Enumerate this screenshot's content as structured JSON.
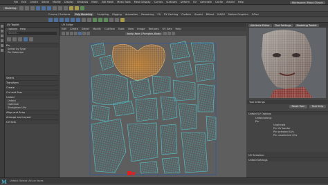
{
  "app": {
    "menus": [
      "File",
      "Edit",
      "Create",
      "Select",
      "Modify",
      "Display",
      "Windows",
      "Mesh",
      "Edit Mesh",
      "Mesh Tools",
      "Mesh Display",
      "Curves",
      "Surfaces",
      "Deform",
      "UV",
      "Generate",
      "Cache",
      "Arnold",
      "Help"
    ],
    "workspace_label": "Workspace: Maya Classic",
    "mode": "Modeling"
  },
  "shelf_tabs": [
    "Curves / Surfaces",
    "Poly Modeling",
    "Sculpting",
    "Rigging",
    "Animation",
    "Rendering",
    "FX",
    "FX Caching",
    "Custom",
    "Arnold",
    "Bifrost",
    "MASH",
    "Motion Graphics",
    "XGen"
  ],
  "active_shelf_tab": "Poly Modeling",
  "uv_toolkit": {
    "title": "UV Toolkit",
    "menus": [
      "Options",
      "Help"
    ],
    "search_placeholder": "Search...",
    "sections": [
      "Pin",
      "Select",
      "Transform",
      "Create",
      "Cut and Sew",
      "Unfold",
      "Align and Snap",
      "Arrange and Layout",
      "UV Sets"
    ],
    "top_rows": [
      "Select by Type",
      "Pin Selection",
      "Invert Pin",
      "Unpin All"
    ],
    "lower_rows": [
      "Unfold",
      "Optimize",
      "Straighten UVs",
      "Layout",
      "Orient Shells",
      "Stack and Orient",
      "Snap Together",
      "Distribute"
    ]
  },
  "uv_editor": {
    "title": "UV Editor",
    "menus": [
      "Edit",
      "Create",
      "Select",
      "Modify",
      "Cut/Sew",
      "Tools",
      "View",
      "Image",
      "Textures",
      "UV Sets",
      "Help"
    ],
    "tab_label": "body_face | Pumpkin_Body"
  },
  "right_panel": {
    "tabs": [
      "Attribute Editor",
      "Tool Settings",
      "Modeling Toolkit"
    ],
    "tool_title": "Tool Settings",
    "reset_label": "Reset Tool",
    "help_label": "Tool Help",
    "section_title": "Unfold UV Options",
    "options": [
      "Unfold along:",
      "Pin",
      "Unpinned",
      "Pin UV border",
      "Pin selected UVs",
      "Pin unselected UVs"
    ],
    "sections2": [
      "UV Selection",
      "Unfold Settings"
    ]
  },
  "bottom": {
    "logo": "M",
    "status": "Unfold: Select UVs or faces"
  },
  "colors": {
    "uv_wire": "#42b8c2",
    "uv_head": "#d9a25a",
    "uv_bg": "#5e5e5e",
    "selected_red": "#e02020"
  }
}
